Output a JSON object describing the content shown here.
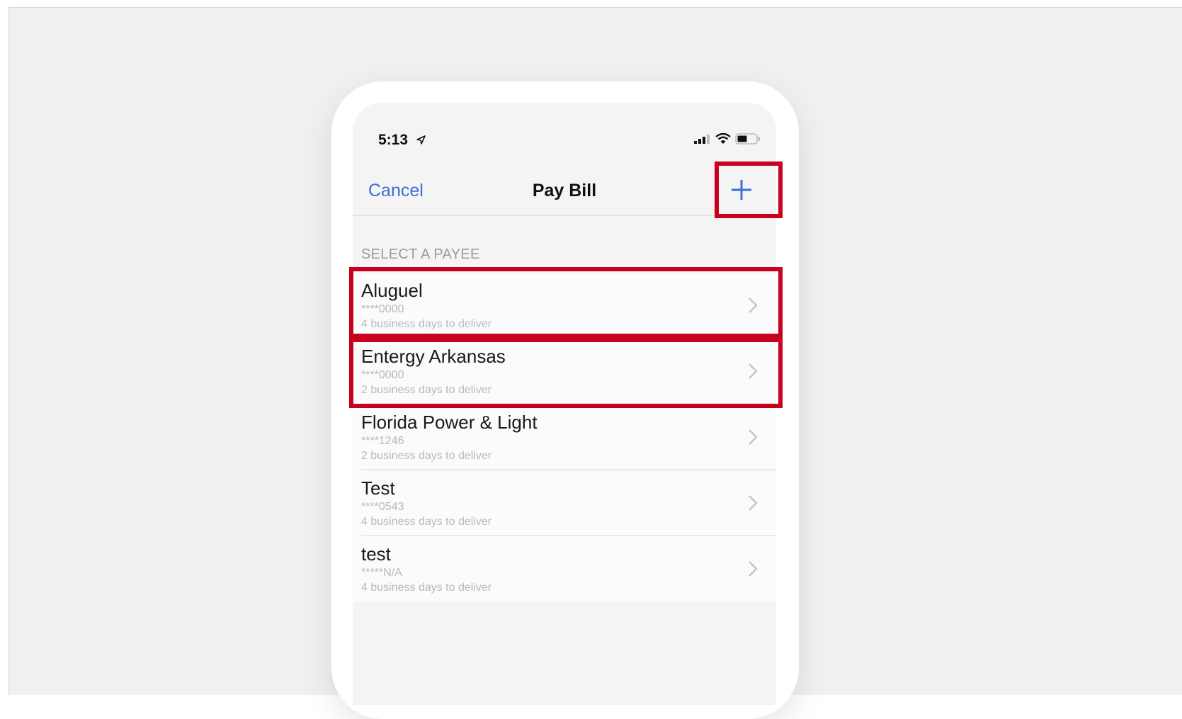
{
  "status_bar": {
    "time": "5:13",
    "icons": [
      "location-arrow-icon",
      "cellular-signal-icon",
      "wifi-icon",
      "battery-icon"
    ]
  },
  "nav": {
    "cancel_label": "Cancel",
    "title": "Pay Bill",
    "add_icon": "plus-icon"
  },
  "section_header": "SELECT A PAYEE",
  "payees": [
    {
      "name": "Aluguel",
      "account": "****0000",
      "delivery": "4 business days to deliver"
    },
    {
      "name": "Entergy Arkansas",
      "account": "****0000",
      "delivery": "2 business days to deliver"
    },
    {
      "name": "Florida Power & Light",
      "account": "****1246",
      "delivery": "2 business days to deliver"
    },
    {
      "name": "Test",
      "account": "****0543",
      "delivery": "4 business days to deliver"
    },
    {
      "name": "test",
      "account": "*****N/A",
      "delivery": "4 business days to deliver"
    }
  ],
  "colors": {
    "accent": "#3d6fd6",
    "highlight": "#c8001e",
    "background": "#f1f0ef"
  }
}
